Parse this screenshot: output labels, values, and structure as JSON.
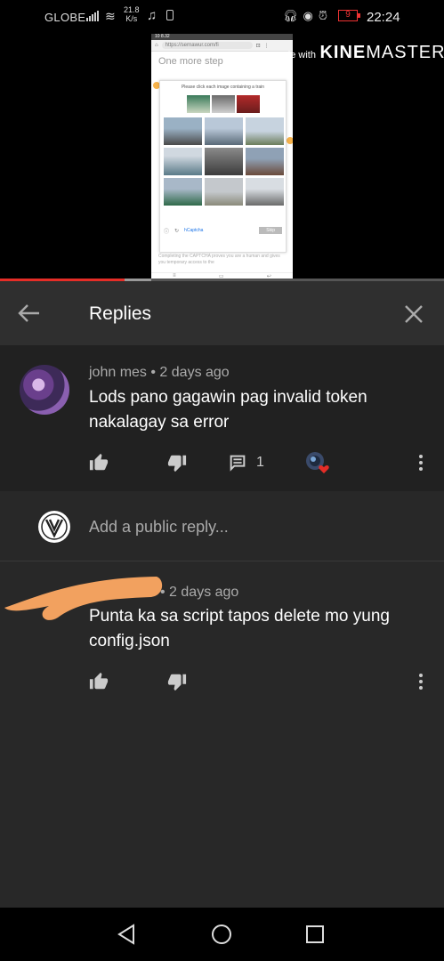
{
  "status_bar": {
    "carrier": "GLOBE",
    "net_speed_value": "21.8",
    "net_speed_unit": "K/s",
    "battery": "9",
    "time": "22:24",
    "icons": [
      "signal-icon",
      "wifi-icon",
      "music-icon",
      "sd-card-icon",
      "headphones-icon",
      "eye-icon",
      "alarm-icon",
      "battery-icon"
    ]
  },
  "video": {
    "watermark_made": "ade with",
    "watermark_brand_bold": "KINE",
    "watermark_brand_light": "MASTER",
    "progress_fraction": 0.28,
    "buffer_fraction": 0.34,
    "phone_screen": {
      "status_time": "10 8.32",
      "url": "https://sernawur.com/fi",
      "heading": "One more step",
      "captcha_prompt": "Please click each image containing a train",
      "captcha_brand": "hCaptcha",
      "captcha_button": "Skip",
      "footer_text": "Completing the CAPTCHA proves you are a human and gives you temporary access to the"
    }
  },
  "header": {
    "title": "Replies",
    "back_icon": "arrow-left-icon",
    "close_icon": "close-icon"
  },
  "parent_comment": {
    "author": "john mes",
    "time": "2 days ago",
    "text": "Lods pano gagawin pag invalid token nakalagay sa error",
    "reply_count": "1",
    "icons": [
      "thumb-up-icon",
      "thumb-down-icon",
      "comment-icon",
      "creator-heart-icon",
      "more-vert-icon"
    ]
  },
  "reply_input": {
    "placeholder": "Add a public reply..."
  },
  "reply_comment": {
    "time": "2 days ago",
    "text": "Punta ka sa script tapos delete mo yung config.json",
    "icons": [
      "thumb-up-icon",
      "thumb-down-icon",
      "more-vert-icon"
    ]
  },
  "nav_bar": {
    "icons": [
      "back-triangle-icon",
      "home-circle-icon",
      "recents-square-icon"
    ]
  },
  "colors": {
    "background": "#282828",
    "header": "#2f2f2f",
    "parent_bg": "#212121",
    "meta_text": "#aaaaaa",
    "progress": "#e52d27",
    "heart": "#e52d27",
    "redaction": "#f2a15f"
  }
}
